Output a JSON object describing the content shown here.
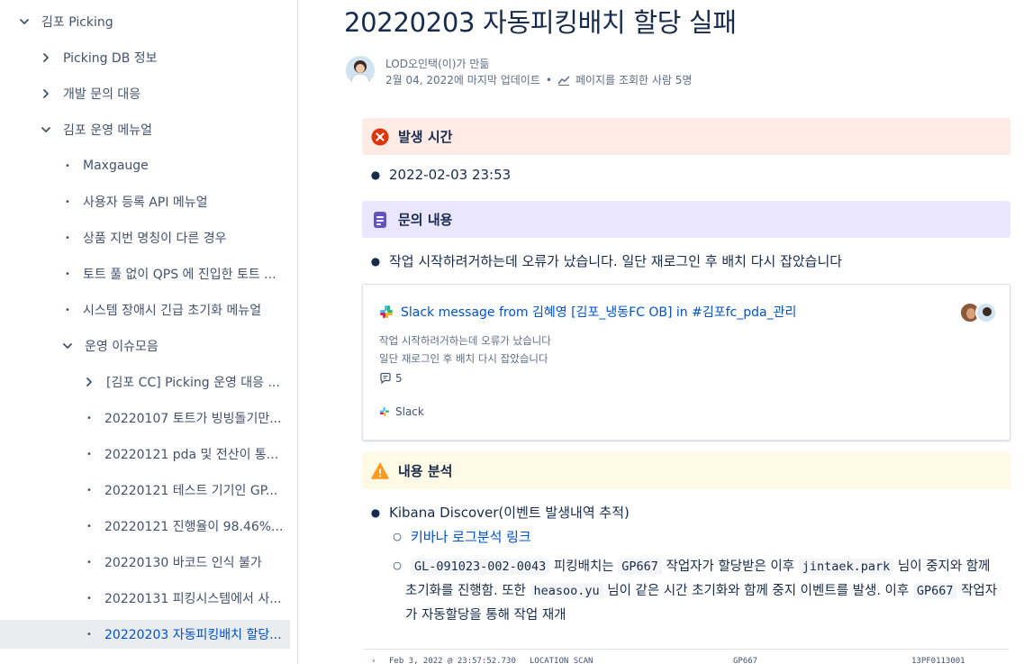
{
  "sidebar": {
    "items": [
      {
        "label": "김포 Picking",
        "type": "expanded",
        "level": 0
      },
      {
        "label": "Picking DB 정보",
        "type": "collapsed",
        "level": 1
      },
      {
        "label": "개발 문의 대응",
        "type": "collapsed",
        "level": 1
      },
      {
        "label": "김포 운영 메뉴얼",
        "type": "expanded",
        "level": 1
      },
      {
        "label": "Maxgauge",
        "type": "leaf",
        "level": 2
      },
      {
        "label": "사용자 등록 API 메뉴얼",
        "type": "leaf",
        "level": 2
      },
      {
        "label": "상품 지번 명칭이 다른 경우",
        "type": "leaf",
        "level": 2
      },
      {
        "label": "토트 풀 없이 QPS 에 진입한 토트 ...",
        "type": "leaf",
        "level": 2
      },
      {
        "label": "시스템 장애시 긴급 초기화 메뉴얼",
        "type": "leaf",
        "level": 2
      },
      {
        "label": "운영 이슈모음",
        "type": "expanded",
        "level": 2
      },
      {
        "label": "[김포 CC] Picking 운영 대응 ...",
        "type": "collapsed",
        "level": 3
      },
      {
        "label": "20220107 토트가 빙빙돌기만...",
        "type": "leaf",
        "level": 3
      },
      {
        "label": "20220121 pda 및 전산이 통...",
        "type": "leaf",
        "level": 3
      },
      {
        "label": "20220121 테스트 기기인 GP...",
        "type": "leaf",
        "level": 3
      },
      {
        "label": "20220121 진행율이 98.46%...",
        "type": "leaf",
        "level": 3
      },
      {
        "label": "20220130 바코드 인식 불가",
        "type": "leaf",
        "level": 3
      },
      {
        "label": "20220131 피킹시스템에서 사...",
        "type": "leaf",
        "level": 3
      },
      {
        "label": "20220203 자동피킹배치 할당...",
        "type": "leaf-active",
        "level": 3
      }
    ]
  },
  "page": {
    "title": "20220203 자동피킹배치 할당 실패",
    "author_line": "LOD오인택(이)가 만듦",
    "updated": "2월 04, 2022에 마지막 업데이트",
    "dot": "•",
    "views": "페이지를 조회한 사람 5명"
  },
  "panels": {
    "occurred_title": "발생 시간",
    "occurred_value": "2022-02-03 23:53",
    "inquiry_title": "문의 내용",
    "inquiry_value": "작업 시작하려거하는데 오류가 났습니다. 일단 재로그인 후 배치 다시 잡았습니다",
    "analysis_title": "내용 분석"
  },
  "slack": {
    "title": "Slack message from 김혜영 [김포_냉동FC OB] in #김포fc_pda_관리",
    "line1": "작업 시작하려거하는데 오류가 났습니다",
    "line2": "일단 재로그인 후 배치 다시 잡았습니다",
    "replies": "5",
    "source": "Slack"
  },
  "analysis": {
    "kibana": "Kibana Discover(이벤트 발생내역 추적)",
    "kibana_link": "키바나 로그분석 링크",
    "code1": "GL-091023-002-0043",
    "t1": "피킹배치는",
    "code2": "GP667",
    "t2": "작업자가 할당받은 이후",
    "code3": "jintaek.park",
    "t3": "님이 중지와 함께",
    "t4": "초기화를 진행함. 또한",
    "code4": "heasoo.yu",
    "t5": "님이 같은 시간 초기화와 함께 중지 이벤트를 발생. 이후",
    "code5": "GP667",
    "t6": "작업자",
    "t7": "가 자동할당을 통해 작업 재개"
  },
  "log": {
    "chevron": "›",
    "time": "Feb 3, 2022 @ 23:57:52.730",
    "event": "LOCATION_SCAN",
    "device": "GP667",
    "id": "13PF0113001"
  },
  "colors": {
    "link": "#0052cc",
    "error_bg": "#ffebe6",
    "note_bg": "#eae6ff",
    "warn_bg": "#fffae6",
    "active_bg": "#ebecf0"
  }
}
